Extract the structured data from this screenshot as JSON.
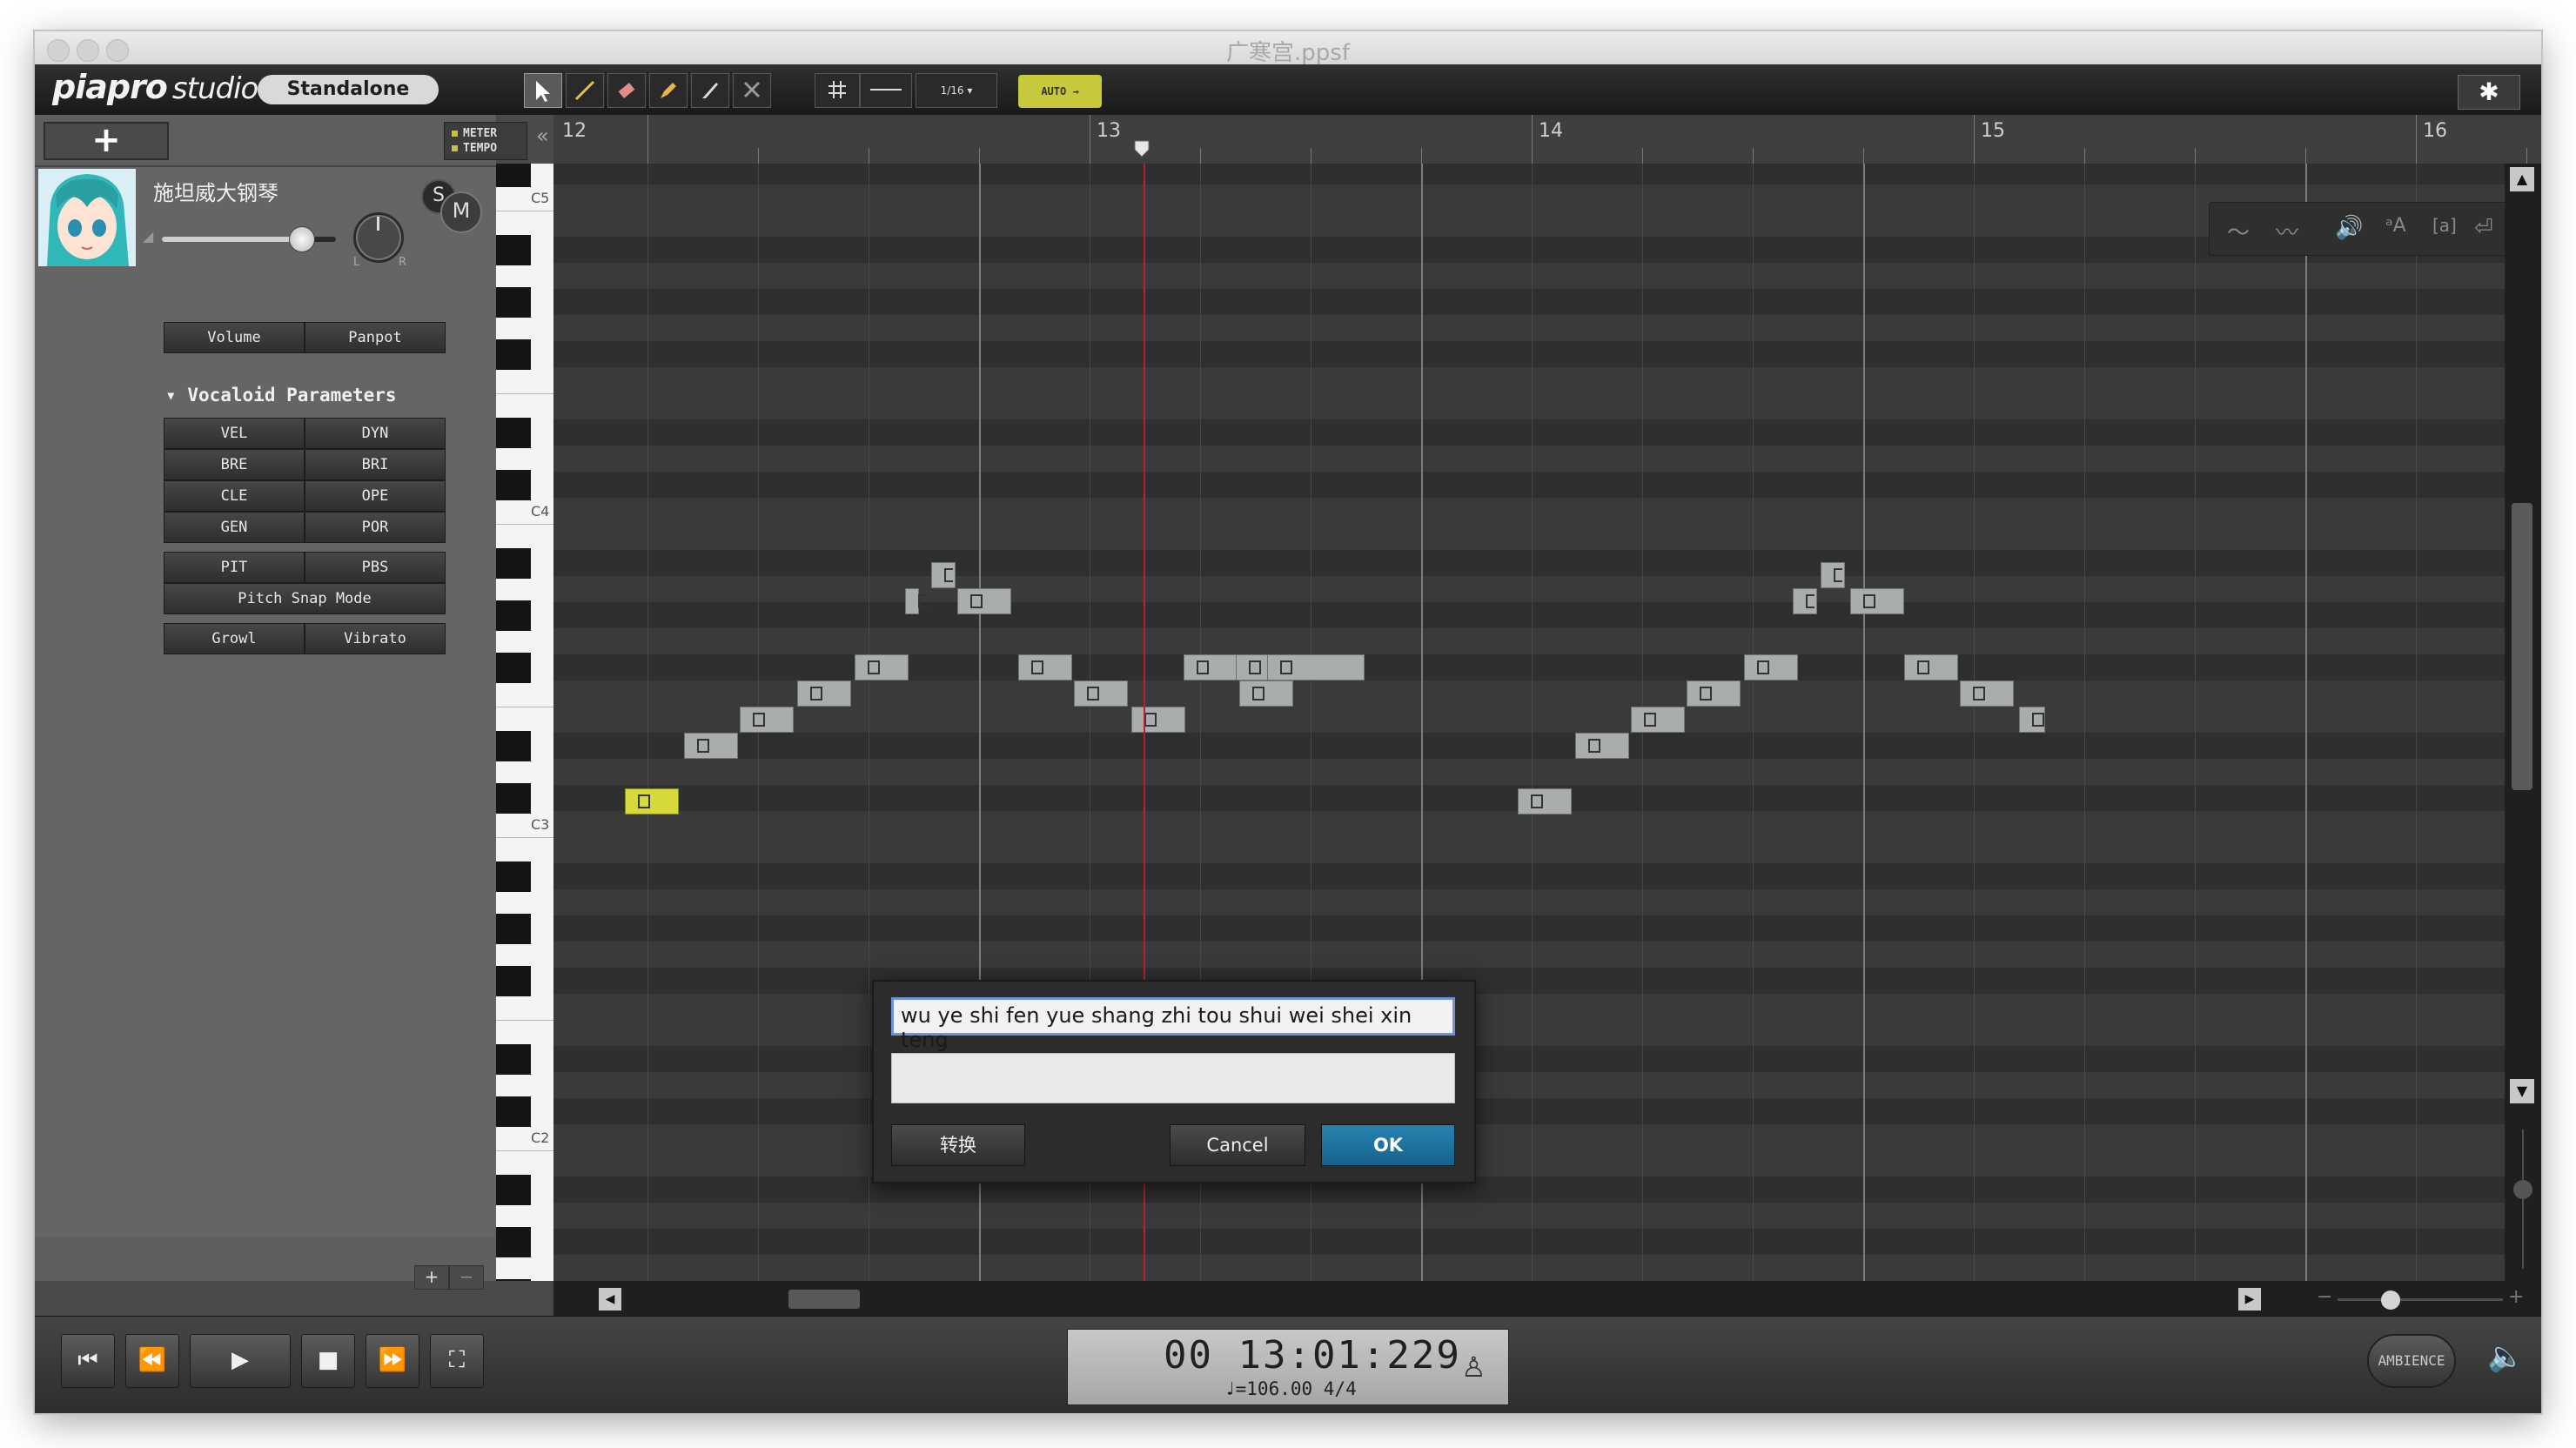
{
  "window": {
    "title": "广寒宫.ppsf"
  },
  "app": {
    "logo_brand": "piapro",
    "logo_product": "studio",
    "badge": "Standalone"
  },
  "toolbar": {
    "auto_label": "AUTO",
    "quantize_label": "1/16",
    "settings_icon": "gear-icon"
  },
  "left_panel": {
    "meter_label": "METER",
    "tempo_label": "TEMPO",
    "track_name": "施坦威大钢琴",
    "solo_label": "S",
    "mute_label": "M",
    "pan_left": "L",
    "pan_right": "R",
    "volume_level": 0.8,
    "mix_buttons": [
      "Volume",
      "Panpot"
    ],
    "vocaloid_params_header": "Vocaloid Parameters",
    "params": [
      [
        "VEL",
        "DYN"
      ],
      [
        "BRE",
        "BRI"
      ],
      [
        "CLE",
        "OPE"
      ],
      [
        "GEN",
        "POR"
      ]
    ],
    "pitch_buttons": [
      "PIT",
      "PBS"
    ],
    "pitch_snap": "Pitch Snap Mode",
    "effects": [
      "Growl",
      "Vibrato"
    ]
  },
  "ruler": {
    "bars": [
      "12",
      "13",
      "14",
      "15",
      "16"
    ]
  },
  "piano": {
    "octaves": [
      "C5",
      "C4",
      "C3",
      "C2"
    ]
  },
  "dialog": {
    "lyric_value": "wu ye shi fen yue shang zhi tou shui wei shei xin teng",
    "phoneme_value": "",
    "convert_label": "转换",
    "cancel_label": "Cancel",
    "ok_label": "OK"
  },
  "transport": {
    "time": "00 13:01:229",
    "tempo": "♩=106.00  4/4",
    "ambience_label": "AMBIENCE"
  },
  "colors": {
    "selected_note": "#d6d93a",
    "note": "#a9aeac",
    "playhead": "#b52424",
    "ok_button": "#1f72a0",
    "auto_button": "#c7c93c"
  }
}
